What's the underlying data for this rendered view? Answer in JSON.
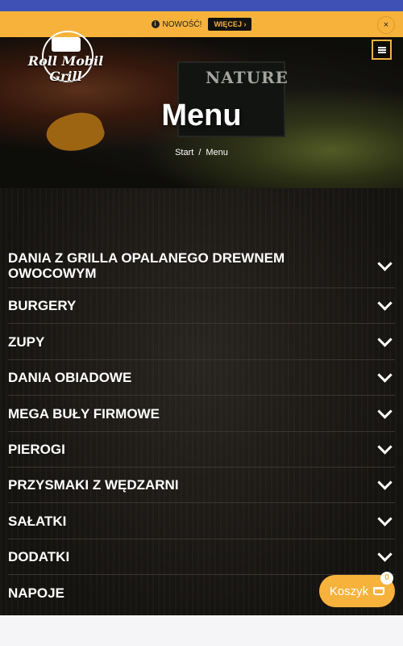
{
  "notice": {
    "text": "NOWOŚĆ!",
    "more_label": "WIĘCEJ ›",
    "close_label": "×"
  },
  "header": {
    "logo_text": "Roll Mobil Grill"
  },
  "hero": {
    "title": "Menu",
    "sign_text": "NATURE",
    "breadcrumb": {
      "home": "Start",
      "separator": "/",
      "current": "Menu"
    }
  },
  "categories": [
    "DANIA Z GRILLA OPALANEGO DREWNEM OWOCOWYM",
    "BURGERY",
    "ZUPY",
    "DANIA OBIADOWE",
    "MEGA BUŁY FIRMOWE",
    "PIEROGI",
    "PRZYSMAKI Z WĘDZARNI",
    "SAŁATKI",
    "DODATKI",
    "NAPOJE"
  ],
  "cart": {
    "label": "Koszyk",
    "count": "0"
  },
  "colors": {
    "accent": "#f7b23b",
    "topbar": "#3f51b5",
    "background_dark": "#1a1714"
  }
}
